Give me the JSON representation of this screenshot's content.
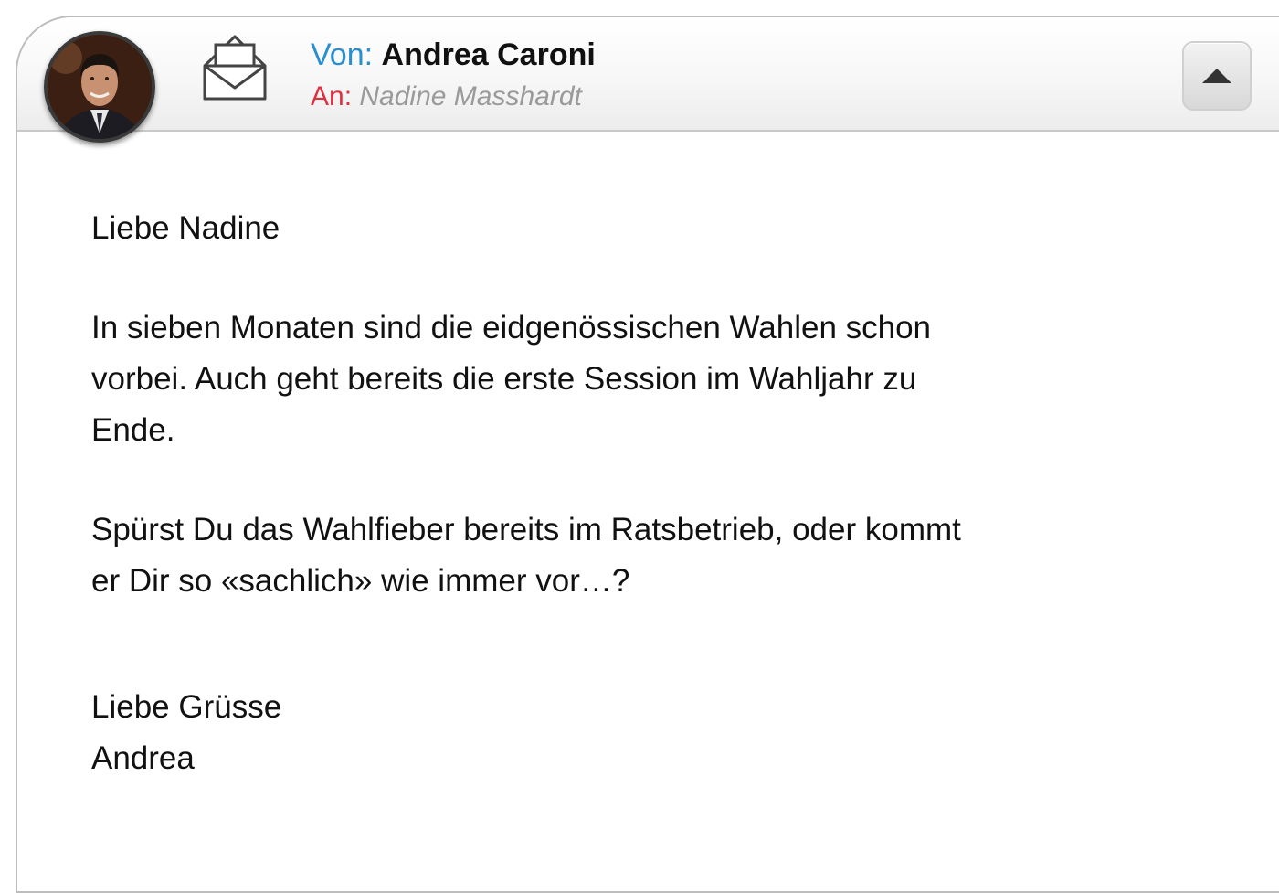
{
  "header": {
    "from_label": "Von:",
    "from_name": "Andrea Caroni",
    "to_label": "An:",
    "to_name": "Nadine Masshardt",
    "avatar_icon": "avatar-photo",
    "envelope_icon": "open-envelope-icon",
    "collapse_icon": "triangle-up-icon"
  },
  "message": {
    "greeting": "Liebe Nadine",
    "paragraph1_lines": [
      "In sieben Monaten sind die eidgenössischen Wahlen schon",
      "vorbei. Auch geht bereits die erste Session im Wahljahr zu",
      "Ende."
    ],
    "paragraph2_lines": [
      "Spürst Du das Wahlfieber bereits im Ratsbetrieb, oder kommt",
      "er Dir so «sachlich» wie immer vor…?"
    ],
    "closing": "Liebe Grüsse",
    "signature": "Andrea"
  },
  "colors": {
    "from_label": "#2a8fd0",
    "to_label": "#e0303f",
    "to_name": "#9a9a9a",
    "border": "#bdbdbd"
  }
}
